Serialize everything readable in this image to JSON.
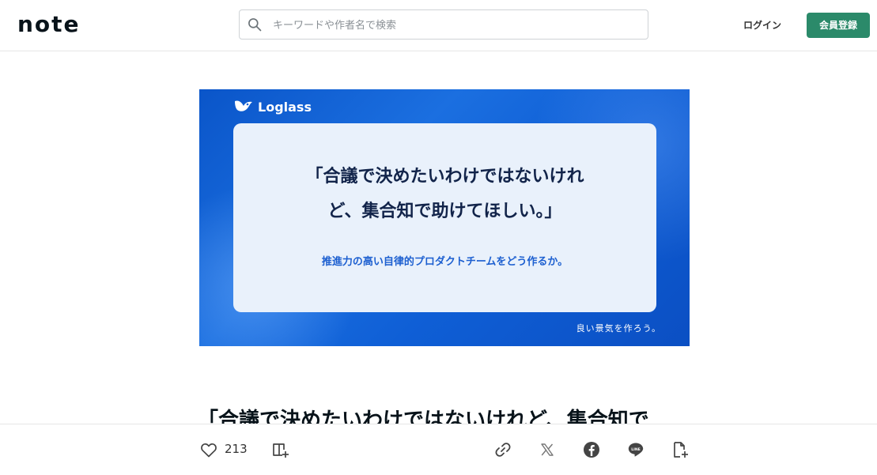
{
  "header": {
    "logo_text": "note",
    "search": {
      "placeholder": "キーワードや作者名で検索",
      "value": ""
    },
    "login_label": "ログイン",
    "signup_label": "会員登録"
  },
  "eyecatch": {
    "brand_name": "Loglass",
    "headline_line1": "「合議で決めたいわけではないけれ",
    "headline_line2": "ど、集合知で助けてほしい。」",
    "subline": "推進力の高い自律的プロダクトチームをどう作るか。",
    "tagline": "良い景気を作ろう。",
    "colors": {
      "background": "#0f5fd6",
      "card": "#e9f1fb",
      "headline": "#12244a",
      "subline": "#1c5fd0"
    }
  },
  "article": {
    "title": "「合議で決めたいわけではないけれど、集合知で"
  },
  "actions": {
    "like_count": "213",
    "icons": [
      "heart-icon",
      "magazine-add-icon",
      "link-icon",
      "x-icon",
      "facebook-icon",
      "line-icon",
      "note-add-icon"
    ]
  },
  "colors": {
    "accent": "#2b8a6a",
    "text": "#08131a",
    "border": "#e6e6e6"
  }
}
